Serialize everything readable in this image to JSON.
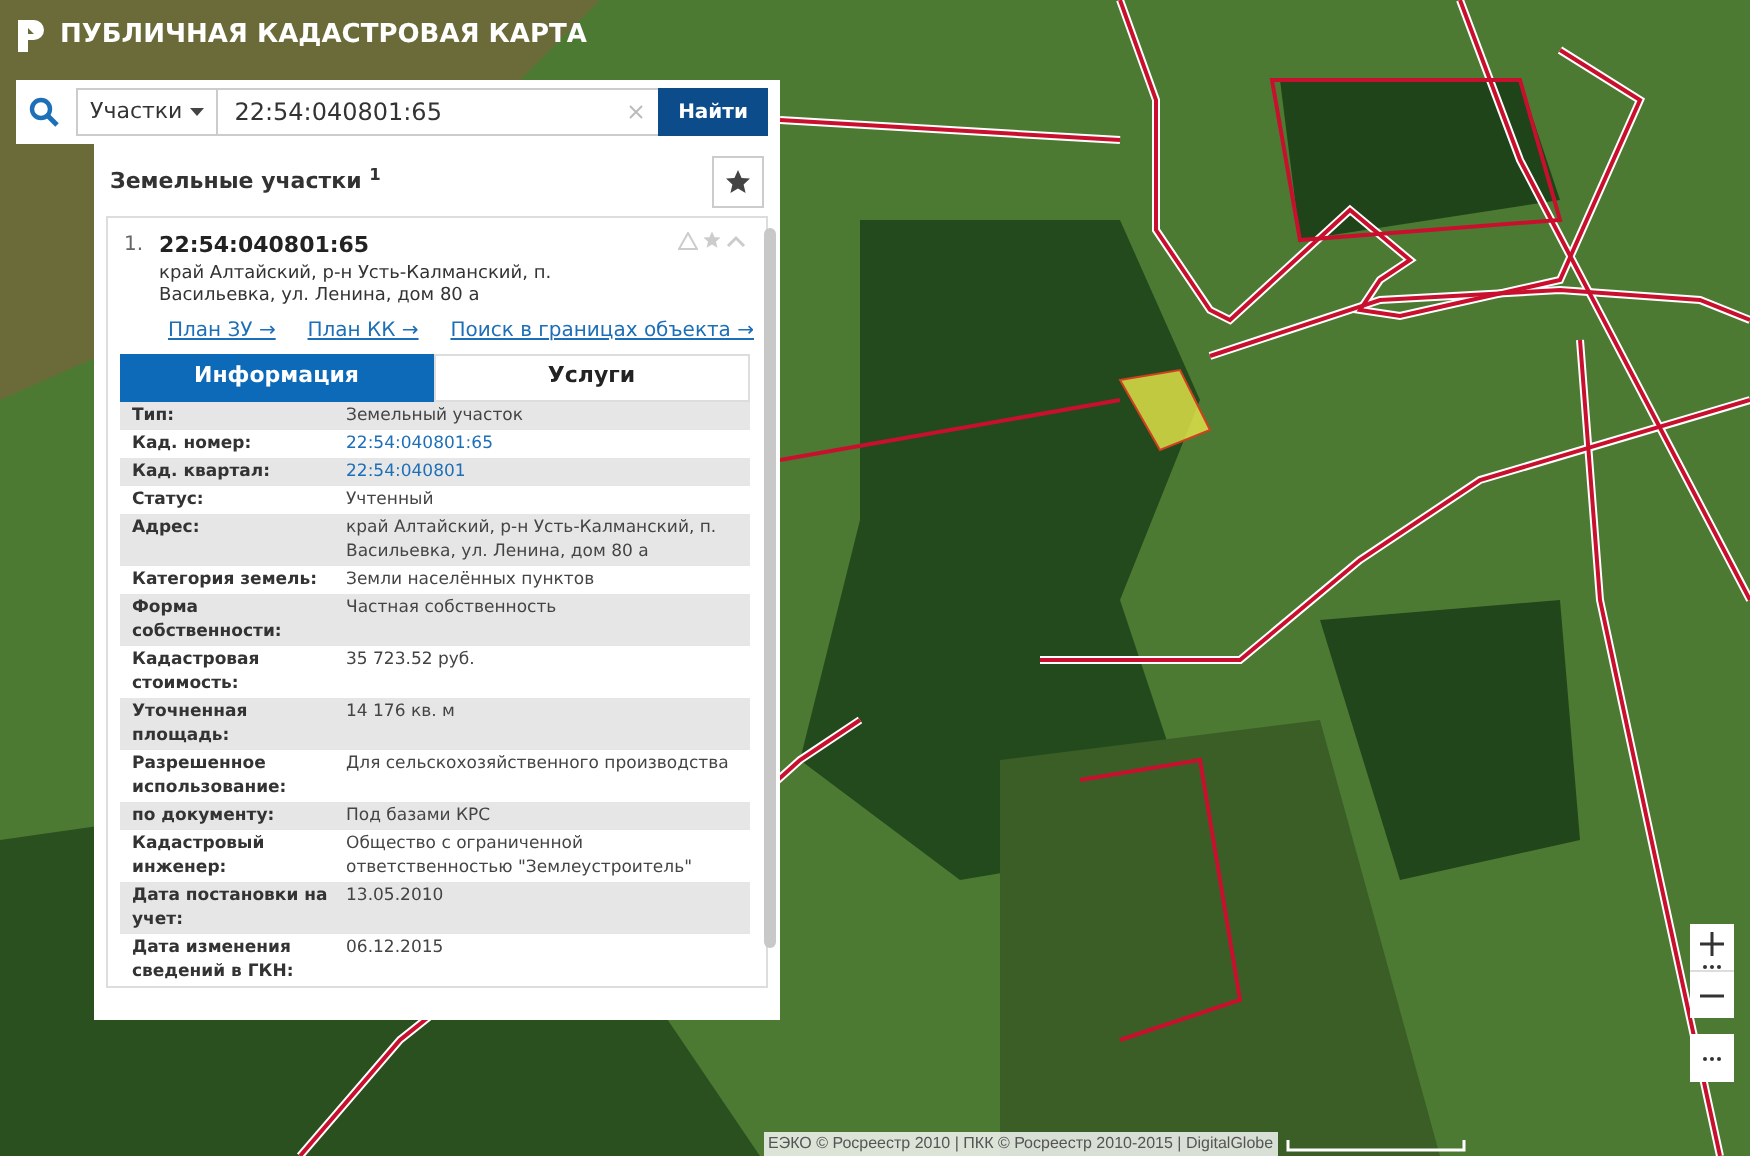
{
  "header": {
    "title": "ПУБЛИЧНАЯ КАДАСТРОВАЯ КАРТА"
  },
  "search": {
    "category": "Участки",
    "value": "22:54:040801:65",
    "button": "Найти"
  },
  "results": {
    "title": "Земельные участки $^{1}$",
    "item": {
      "index": "1.",
      "number": "22:54:040801:65",
      "address": "край Алтайский, р-н Усть-Калманский, п. Васильевка, ул. Ленина, дом 80 а",
      "links": [
        "План ЗУ →",
        "План КК →",
        "Поиск в границах объекта →"
      ],
      "tabs": [
        {
          "label": "Информация",
          "selected": true
        },
        {
          "label": "Услуги",
          "selected": false
        }
      ],
      "rows": [
        {
          "label": "Тип:",
          "value": "Земельный участок",
          "kind": "text"
        },
        {
          "label": "Кад. номер:",
          "value": "22:54:040801:65",
          "kind": "link"
        },
        {
          "label": "Кад. квартал:",
          "value": "22:54:040801",
          "kind": "link"
        },
        {
          "label": "Статус:",
          "value": "Учтенный",
          "kind": "text"
        },
        {
          "label": "Адрес:",
          "value": "край Алтайский, р-н Усть-Калманский, п. Васильевка, ул. Ленина, дом 80 а",
          "kind": "text"
        },
        {
          "label": "Категория земель:",
          "value": "Земли населённых пунктов",
          "kind": "text"
        },
        {
          "label": "Форма собственности:",
          "value": "Частная собственность",
          "kind": "text"
        },
        {
          "label": "Кадастровая стоимость:",
          "value": "35 723.52 руб.",
          "kind": "text"
        },
        {
          "label": "Уточненная площадь:",
          "value": "14 176 кв. м",
          "kind": "text"
        },
        {
          "label": "Разрешенное использование:",
          "value": "Для сельскохозяйственного производства",
          "kind": "text"
        },
        {
          "label": "по документу:",
          "value": "Под базами КРС",
          "kind": "text"
        },
        {
          "label": "Кадастровый инженер:",
          "value": "Общество с ограниченной ответственностью \"Землеустроитель\"",
          "kind": "text"
        },
        {
          "label": "Дата постановки на учет:",
          "value": "13.05.2010",
          "kind": "text"
        },
        {
          "label": "Дата изменения сведений в ГКН:",
          "value": "06.12.2015",
          "kind": "text"
        }
      ]
    }
  },
  "map": {
    "attribution": "ЕЭКО © Росреестр 2010 | ПКК © Росреестр 2010-2015 | DigitalGlobe"
  }
}
